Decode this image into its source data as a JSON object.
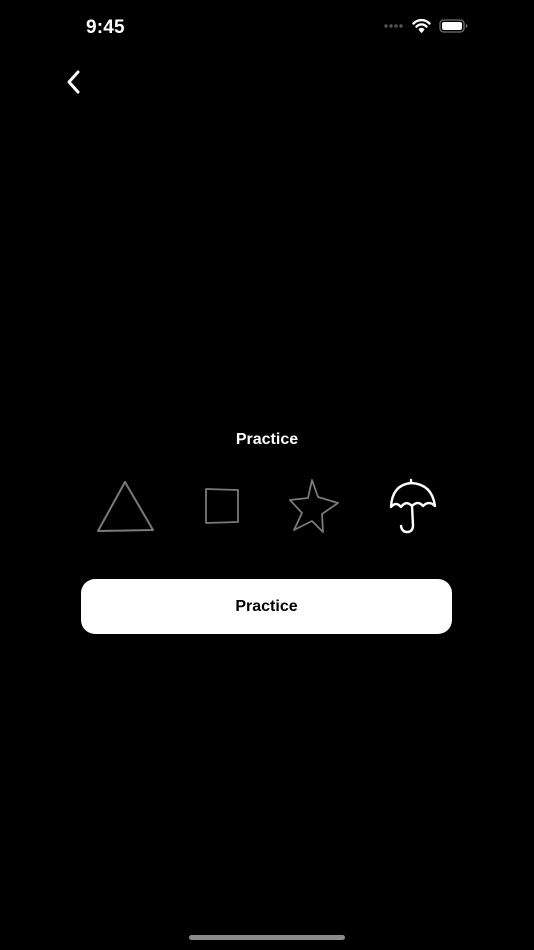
{
  "status_bar": {
    "time": "9:45",
    "icons": [
      "signal-icon",
      "wifi-icon",
      "battery-icon"
    ]
  },
  "navigation": {
    "back_icon": "chevron-left-icon"
  },
  "practice": {
    "title": "Practice",
    "shapes": [
      {
        "name": "triangle",
        "icon": "triangle-icon",
        "selected": false
      },
      {
        "name": "square",
        "icon": "square-icon",
        "selected": false
      },
      {
        "name": "star",
        "icon": "star-icon",
        "selected": false
      },
      {
        "name": "umbrella",
        "icon": "umbrella-icon",
        "selected": true
      }
    ],
    "button_label": "Practice"
  },
  "colors": {
    "background": "#000000",
    "text": "#ffffff",
    "shape_inactive": "#7a7a7a",
    "shape_active": "#ffffff",
    "button_bg": "#ffffff",
    "button_text": "#000000"
  }
}
